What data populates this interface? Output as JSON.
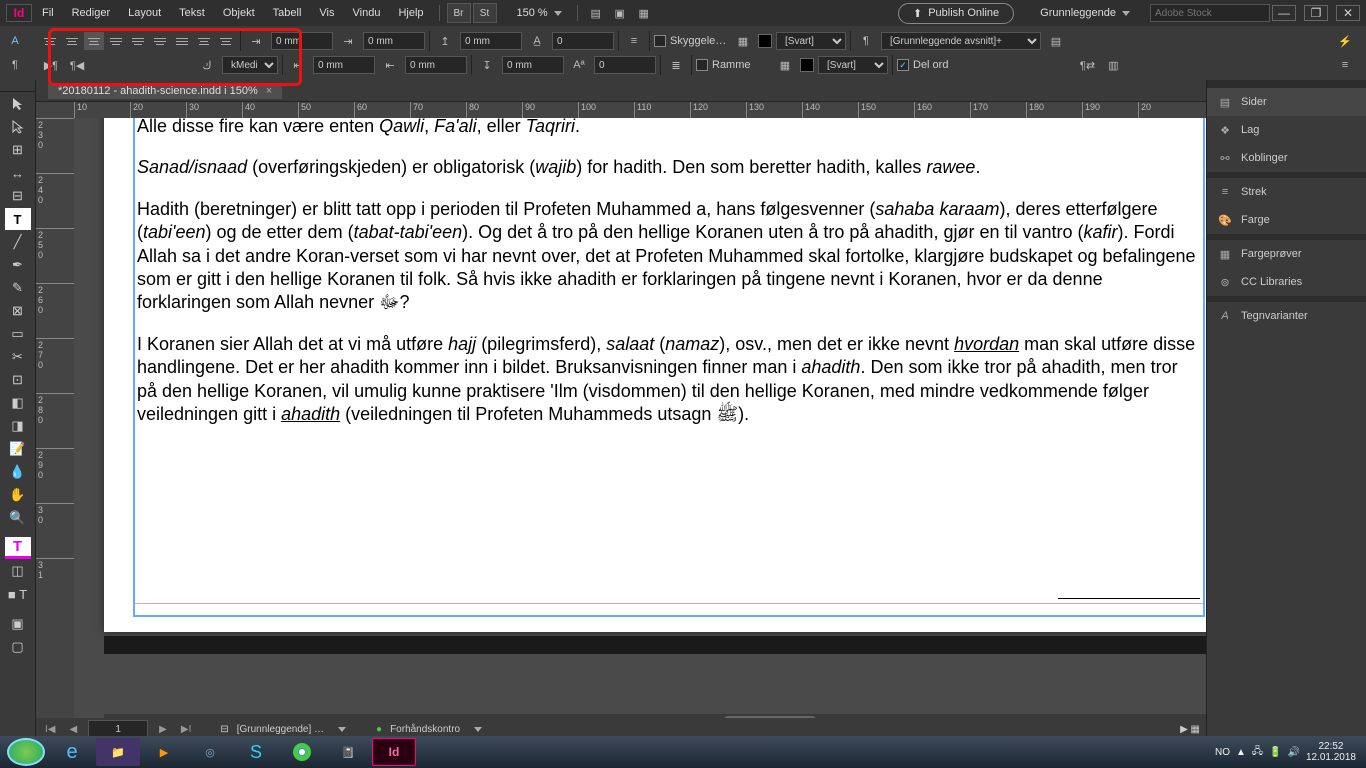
{
  "menu": {
    "items": [
      "Fil",
      "Rediger",
      "Layout",
      "Tekst",
      "Objekt",
      "Tabell",
      "Vis",
      "Vindu",
      "Hjelp"
    ],
    "zoom": "150 %",
    "publish": "Publish Online",
    "workspace": "Grunnleggende",
    "search_placeholder": "Adobe Stock"
  },
  "win": {
    "min": "—",
    "rest": "❐",
    "close": "✕"
  },
  "control": {
    "indent_left": "0 mm",
    "indent_right": "0 mm",
    "first_line": "0 mm",
    "last_line": "0 mm",
    "space_before": "0 mm",
    "space_after": "0 mm",
    "drop_lines": "0",
    "drop_chars": "0",
    "shading_label": "Skyggele…",
    "shading_swatch": "[Svart]",
    "border_label": "Ramme",
    "border_swatch": "[Svart]",
    "para_style": "[Grunnleggende avsnitt]+",
    "hyphenate": "Del ord",
    "font_select": "kMedi..."
  },
  "tab": {
    "title": "*20180112 - ahadith-science.indd i 150%"
  },
  "ruler_marks": [
    "10",
    "20",
    "30",
    "40",
    "50",
    "60",
    "70",
    "80",
    "90",
    "100",
    "110",
    "120",
    "130",
    "140",
    "150",
    "160",
    "170",
    "180",
    "190",
    "20"
  ],
  "vruler": [
    "2\n3\n0",
    "2\n4\n0",
    "2\n5\n0",
    "2\n6\n0",
    "2\n7\n0",
    "2\n8\n0",
    "2\n9\n0",
    "3\n0",
    "3\n1"
  ],
  "page": {
    "number": "1",
    "master_style": "[Grunnleggende] …",
    "preflight": "Forhåndskontro"
  },
  "panels": [
    "Sider",
    "Lag",
    "Koblinger",
    "Strek",
    "Farge",
    "Fargeprøver",
    "CC Libraries",
    "Tegnvarianter"
  ],
  "doc": {
    "p1_a": "Alle disse fire kan være enten ",
    "p1_q": "Qawli",
    "p1_c": ", ",
    "p1_f": "Fa'ali",
    "p1_e": ", eller ",
    "p1_t": "Taqriri",
    "p1_end": ".",
    "p2_a": "Sanad/isnaad",
    "p2_b": " (overføringskjeden) er obligatorisk (",
    "p2_w": "wajib",
    "p2_c": ") for hadith. Den som beretter hadith, kalles ",
    "p2_r": "rawee",
    "p2_end": ".",
    "p3_a": "Hadith (beretninger) er blitt tatt opp i perioden til Profeten Muhammed a, hans følgesvenner (",
    "p3_sk": "sahaba karaam",
    "p3_b": "), deres etterfølgere (",
    "p3_t": "tabi'een",
    "p3_c": ") og de etter dem (",
    "p3_tt": "tabat-tabi'een",
    "p3_d": "). Og det å tro på den hellige Koranen uten å tro på ahadith, gjør en til vantro (",
    "p3_k": "kafir",
    "p3_e": "). Fordi Allah sa i det andre Koran-verset som vi har nevnt over, det at Profeten Muhammed skal fortolke, klargjøre budskapet og befalingene som er gitt i den hellige Koranen til folk. Så hvis ikke ahadith er forklaringen på tingene nevnt i Koranen, hvor er da denne forklaringen som Allah nevner ﷻ?",
    "p4_a": "I Koranen sier Allah det at vi må utføre ",
    "p4_h": "hajj",
    "p4_b": " (pilegrimsferd), ",
    "p4_s": "salaat",
    "p4_c": " (",
    "p4_n": "namaz",
    "p4_d": "), osv., men det er ikke nevnt ",
    "p4_hv": "hvordan",
    "p4_e": " man skal utføre disse handlingene. Det er her ahadith kommer inn i bildet. Bruksanvisningen finner man i ",
    "p4_ah": "ahadith",
    "p4_f": ". Den som ikke tror på ahadith, men tror på den hellige Koranen, vil umulig kunne praktisere 'Ilm (visdommen) til den hellige Koranen, med mindre vedkommende følger veiledningen gitt i ",
    "p4_ah2": "ahadith",
    "p4_g": " (veiledningen til Profeten Muhammeds utsagn ﷺ)."
  },
  "tray": {
    "lang": "NO",
    "time": "22:52",
    "date": "12.01.2018"
  }
}
